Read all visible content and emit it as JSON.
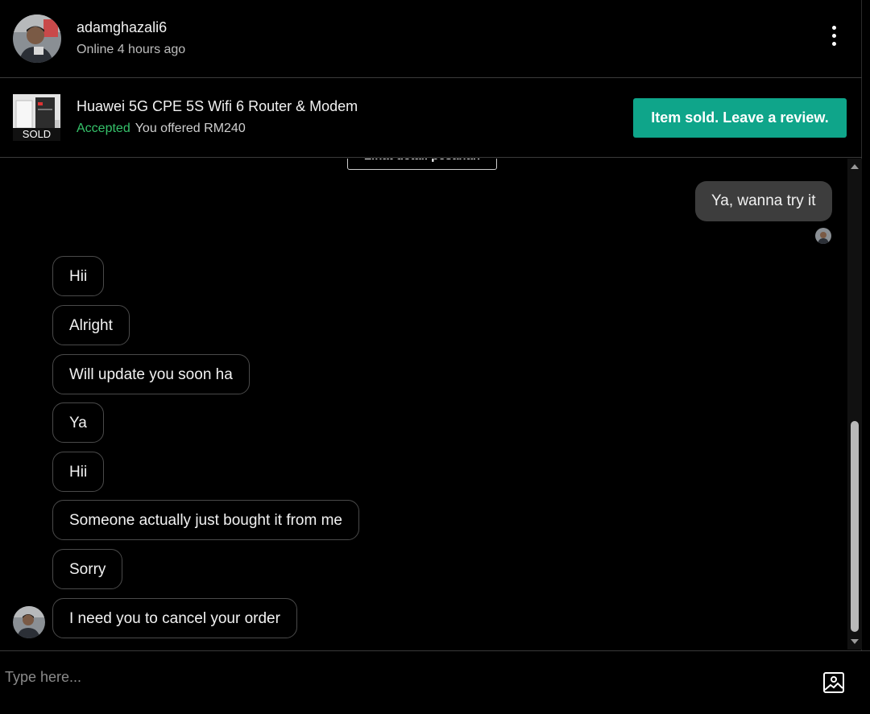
{
  "header": {
    "username": "adamghazali6",
    "status": "Online 4 hours ago"
  },
  "listing": {
    "thumb_badge": "SOLD",
    "product_name": "Huawei 5G CPE 5S Wifi 6 Router & Modem",
    "offer_status": "Accepted",
    "offer_text": "You offered RM240",
    "review_button": "Item sold. Leave a review."
  },
  "chat": {
    "detail_button": "Lihat detail pesanan",
    "outgoing": [
      {
        "text": "Ya, wanna try it"
      }
    ],
    "incoming": [
      {
        "text": "Hii"
      },
      {
        "text": "Alright"
      },
      {
        "text": "Will update you soon ha"
      },
      {
        "text": "Ya"
      },
      {
        "text": "Hii"
      },
      {
        "text": "Someone actually just bought it from me"
      },
      {
        "text": "Sorry"
      },
      {
        "text": "I need you to cancel your order"
      }
    ]
  },
  "input": {
    "placeholder": "Type here..."
  },
  "icons": {
    "menu": "kebab-menu-icon",
    "attach": "image-upload-icon"
  },
  "colors": {
    "accent": "#0fa58a",
    "accepted": "#35c26a"
  }
}
